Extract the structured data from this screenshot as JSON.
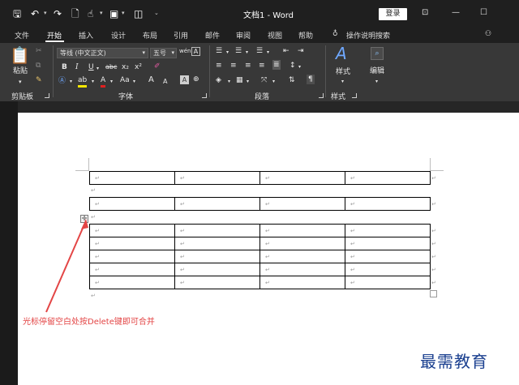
{
  "titlebar": {
    "doc_title": "文档1 - Word",
    "login_label": "登录",
    "icons": [
      "save-icon",
      "undo-icon",
      "redo-icon",
      "new-doc-icon",
      "touch-mode-icon",
      "page-layout-icon",
      "customize-qat-icon"
    ]
  },
  "tabs": [
    {
      "label": "文件"
    },
    {
      "label": "开始"
    },
    {
      "label": "插入"
    },
    {
      "label": "设计"
    },
    {
      "label": "布局"
    },
    {
      "label": "引用"
    },
    {
      "label": "邮件"
    },
    {
      "label": "审阅"
    },
    {
      "label": "视图"
    },
    {
      "label": "帮助"
    }
  ],
  "tell_me": "操作说明搜索",
  "ribbon": {
    "paste_label": "粘贴",
    "font_name": "等线 (中文正文)",
    "font_size": "五号",
    "bold": "B",
    "italic": "I",
    "underline": "U",
    "strike": "abc",
    "subscript": "x₂",
    "superscript": "x²",
    "case_label": "Aa",
    "grow_font": "A",
    "shrink_font": "A",
    "styles_label": "样式",
    "edit_label": "编辑",
    "groups": {
      "clipboard": "剪贴板",
      "font": "字体",
      "paragraph": "段落",
      "styles": "样式"
    }
  },
  "document": {
    "cell_mark": "↵",
    "para_mark": "↵",
    "move_handle": "✛",
    "annotation": "光标停留空白处按Delete键即可合并"
  },
  "watermark": "最需教育",
  "colors": {
    "titlebar_bg": "#1f1f1f",
    "ribbon_bg": "#383838",
    "annotation_red": "#e34545",
    "watermark_blue": "#1a3f8f"
  }
}
